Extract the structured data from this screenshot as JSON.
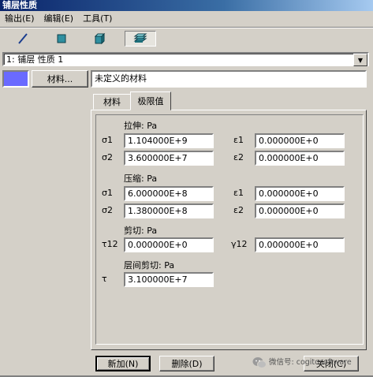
{
  "window": {
    "title": "铺层性质"
  },
  "menu": [
    {
      "label": "输出(E)"
    },
    {
      "label": "编辑(E)"
    },
    {
      "label": "工具(T)"
    }
  ],
  "toolbar": {
    "items": [
      {
        "icon": "line-element-icon"
      },
      {
        "icon": "shell-element-icon"
      },
      {
        "icon": "solid-element-icon"
      },
      {
        "icon": "layered-element-icon",
        "pressed": true
      }
    ]
  },
  "layer_select": {
    "value": "1: 铺层 性质 1"
  },
  "material": {
    "color": "#6a6aff",
    "button_label": "材料...",
    "name": "未定义的材料"
  },
  "tabs": [
    {
      "label": "材料",
      "active": false
    },
    {
      "label": "极限值",
      "active": true
    }
  ],
  "limits": {
    "tension": {
      "title": "拉伸: Pa",
      "sigma1_label": "σ1",
      "sigma1": "1.104000E+9",
      "eps1_label": "ε1",
      "eps1": "0.000000E+0",
      "sigma2_label": "σ2",
      "sigma2": "3.600000E+7",
      "eps2_label": "ε2",
      "eps2": "0.000000E+0"
    },
    "compression": {
      "title": "压缩: Pa",
      "sigma1_label": "σ1",
      "sigma1": "6.000000E+8",
      "eps1_label": "ε1",
      "eps1": "0.000000E+0",
      "sigma2_label": "σ2",
      "sigma2": "1.380000E+8",
      "eps2_label": "ε2",
      "eps2": "0.000000E+0"
    },
    "shear": {
      "title": "剪切: Pa",
      "tau12_label": "τ12",
      "tau12": "0.000000E+0",
      "gamma12_label": "γ12",
      "gamma12": "0.000000E+0"
    },
    "interlaminar": {
      "title": "层间剪切: Pa",
      "tau_label": "τ",
      "tau": "3.100000E+7"
    }
  },
  "buttons": {
    "new": "新加(N)",
    "delete": "删除(D)",
    "close": "关闭(C)"
  },
  "watermark": "微信号: cogitosoftware"
}
